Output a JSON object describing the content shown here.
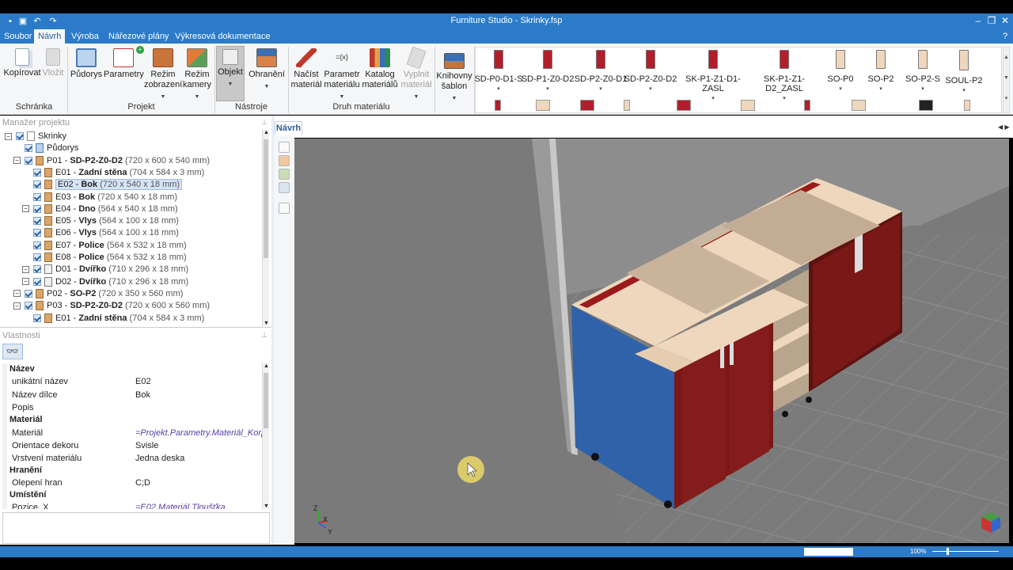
{
  "window": {
    "title": "Furniture Studio - Skrinky.fsp"
  },
  "menu": [
    "Soubor",
    "Návrh",
    "Výroba",
    "Nářezové plány",
    "Výkresová dokumentace"
  ],
  "menu_active_index": 1,
  "ribbon": {
    "kopirovat": "Kopírovat",
    "vlozit": "Vložit",
    "pudorys": "Půdorys",
    "parametry": "Parametry",
    "rezim_zobrazeni_1": "Režim",
    "rezim_zobrazeni_2": "zobrazení",
    "rezim_kamery_1": "Režim",
    "rezim_kamery_2": "kamery",
    "objekt": "Objekt",
    "ohraneni": "Ohranění",
    "nacist_material_1": "Načíst",
    "nacist_material_2": "materiál",
    "parametr_materialu_1": "Parametr",
    "parametr_materialu_2": "materiálu",
    "katalog_materialu_1": "Katalog",
    "katalog_materialu_2": "materiálů",
    "vyplnit_material_1": "Vyplnit",
    "vyplnit_material_2": "materiál",
    "knihovny_sablon_1": "Knihovny",
    "knihovny_sablon_2": "šablon",
    "groups": {
      "schranka": "Schránka",
      "projekt": "Projekt",
      "nastroje": "Nástroje",
      "druh_materialu": "Druh materiálu"
    },
    "parametry_glyph": "={x}",
    "parametr_glyph": "={x}"
  },
  "templates": [
    "SD-P0-D1-S",
    "SD-P1-Z0-D2",
    "SD-P2-Z0-D1",
    "SD-P2-Z0-D2",
    "SK-P1-Z1-D1-ZASL",
    "SK-P1-Z1-D2_ZASL",
    "SO-P0",
    "SO-P2",
    "SO-P2-S",
    "SOUL-P2"
  ],
  "project_manager": {
    "title": "Manažer projektu",
    "rows": [
      {
        "code": "",
        "name": "Skrinky",
        "dim": ""
      },
      {
        "code": "",
        "name": "Půdorys",
        "dim": ""
      },
      {
        "code": "P01 - ",
        "name": "SD-P2-Z0-D2",
        "dim": " (720 x 600 x 540 mm)"
      },
      {
        "code": "E01 - ",
        "name": "Zadní stěna",
        "dim": " (704 x 584 x 3 mm)"
      },
      {
        "code": "E02 - ",
        "name": "Bok",
        "dim": " (720 x 540 x 18 mm)"
      },
      {
        "code": "E03 - ",
        "name": "Bok",
        "dim": " (720 x 540 x 18 mm)"
      },
      {
        "code": "E04 - ",
        "name": "Dno",
        "dim": " (564 x 540 x 18 mm)"
      },
      {
        "code": "E05 - ",
        "name": "Vlys",
        "dim": " (564 x 100 x 18 mm)"
      },
      {
        "code": "E06 - ",
        "name": "Vlys",
        "dim": " (564 x 100 x 18 mm)"
      },
      {
        "code": "E07 - ",
        "name": "Police",
        "dim": " (564 x 532 x 18 mm)"
      },
      {
        "code": "E08 - ",
        "name": "Police",
        "dim": " (564 x 532 x 18 mm)"
      },
      {
        "code": "D01 - ",
        "name": "Dvířko",
        "dim": " (710 x 296 x 18 mm)"
      },
      {
        "code": "D02 - ",
        "name": "Dvířko",
        "dim": " (710 x 296 x 18 mm)"
      },
      {
        "code": "P02 - ",
        "name": "SO-P2",
        "dim": " (720 x 350 x 560 mm)"
      },
      {
        "code": "P03 - ",
        "name": "SD-P2-Z0-D2",
        "dim": " (720 x 600 x 560 mm)"
      },
      {
        "code": "E01 - ",
        "name": "Zadní stěna",
        "dim": " (704 x 584 x 3 mm)"
      }
    ]
  },
  "properties": {
    "title": "Vlastnosti",
    "sections": {
      "nazev": "Název",
      "material": "Materiál",
      "hraneni": "Hranění",
      "umisteni": "Umístění"
    },
    "rows": {
      "unikatni_nazev": {
        "label": "unikátní název",
        "value": "E02"
      },
      "nazev_dilce": {
        "label": "Název dílce",
        "value": "Bok"
      },
      "popis": {
        "label": "Popis",
        "value": ""
      },
      "material": {
        "label": "Materiál",
        "value": "=Projekt.Parametry.Materiál_Korpus"
      },
      "orientace": {
        "label": "Orientace dekoru",
        "value": "Svisle"
      },
      "vrstveni": {
        "label": "Vrstvení materiálu",
        "value": "Jedna deska"
      },
      "olepeni": {
        "label": "Olepení hran",
        "value": "C;D"
      },
      "pozice_x": {
        "label": "Pozice_X",
        "value": "=E02.Materiál.Tloušťka"
      }
    }
  },
  "viewport": {
    "tab": "Návrh",
    "axes": {
      "z": "Z",
      "x": "X",
      "y": "Y"
    }
  },
  "statusbar": {
    "zoom": "100%"
  },
  "colors": {
    "accent": "#2b7bc9",
    "door_red": "#7a1818",
    "panel_blue": "#2f62a8",
    "board": "#eed7bd"
  }
}
